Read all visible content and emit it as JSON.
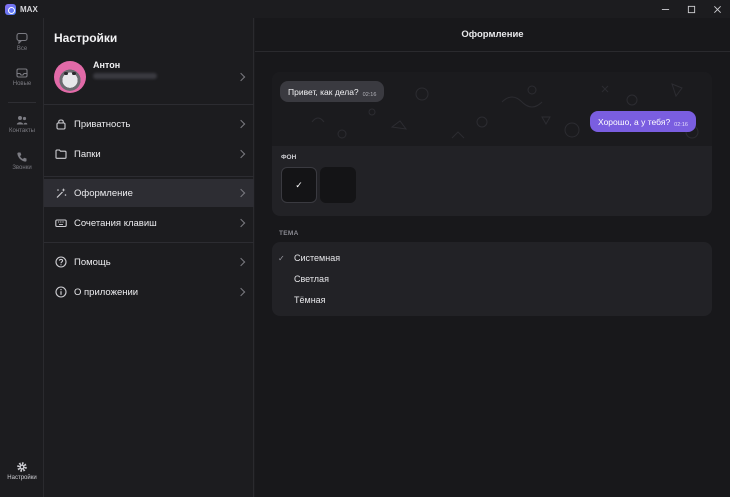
{
  "window": {
    "title": "MAX"
  },
  "rail": {
    "items": [
      {
        "label": "Все",
        "icon": "chat-icon"
      },
      {
        "label": "Новые",
        "icon": "inbox-icon"
      },
      {
        "label": "Контакты",
        "icon": "contacts-icon"
      },
      {
        "label": "Звонки",
        "icon": "phone-icon"
      }
    ],
    "settings_label": "Настройки"
  },
  "settings": {
    "title": "Настройки",
    "profile": {
      "name": "Антон"
    },
    "menu": [
      {
        "label": "Приватность",
        "icon": "lock-icon"
      },
      {
        "label": "Папки",
        "icon": "folder-icon"
      },
      {
        "label": "Оформление",
        "icon": "magic-wand-icon",
        "active": true
      },
      {
        "label": "Сочетания клавиш",
        "icon": "keyboard-icon"
      },
      {
        "label": "Помощь",
        "icon": "help-icon"
      },
      {
        "label": "О приложении",
        "icon": "info-icon"
      }
    ]
  },
  "appearance": {
    "header": "Оформление",
    "preview": {
      "incoming_text": "Привет, как дела?",
      "incoming_time": "02:16",
      "outgoing_text": "Хорошо, а у тебя?",
      "outgoing_time": "02:16"
    },
    "background_label": "ФОН",
    "selected_mark": "✓",
    "theme_label": "ТЕМА",
    "themes": [
      {
        "label": "Системная",
        "selected": true
      },
      {
        "label": "Светлая",
        "selected": false
      },
      {
        "label": "Тёмная",
        "selected": false
      }
    ]
  },
  "colors": {
    "accent": "#7a5ee0",
    "active_item": "#2d2d33",
    "background": "#18181b"
  }
}
